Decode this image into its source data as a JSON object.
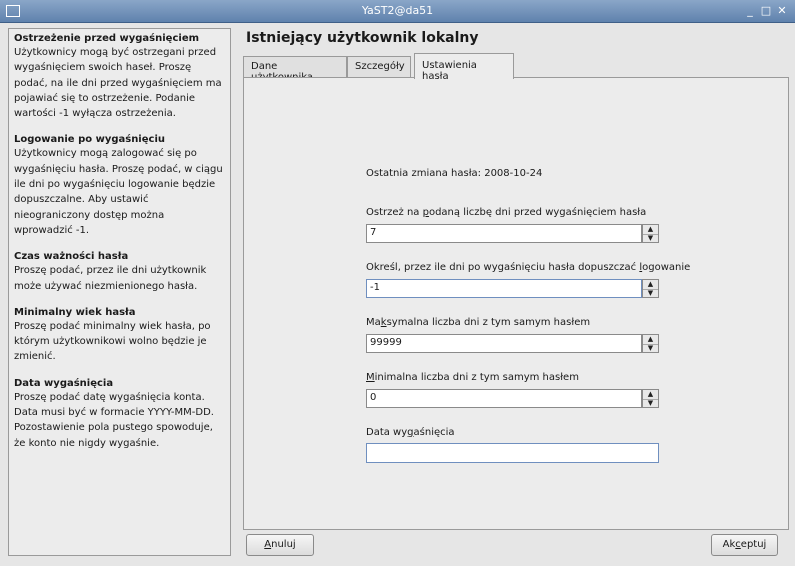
{
  "window": {
    "title": "YaST2@da51"
  },
  "help": [
    {
      "heading": "Ostrzeżenie przed wygaśnięciem",
      "body": "Użytkownicy mogą być ostrzegani przed wygaśnięciem swoich haseł. Proszę podać, na ile dni przed wygaśnięciem ma pojawiać się to ostrzeżenie. Podanie wartości -1 wyłącza ostrzeżenia."
    },
    {
      "heading": "Logowanie po wygaśnięciu",
      "body": "Użytkownicy mogą zalogować się po wygaśnięciu hasła. Proszę podać, w ciągu ile dni po wygaśnięciu logowanie będzie dopuszczalne. Aby ustawić nieograniczony dostęp można wprowadzić -1."
    },
    {
      "heading": "Czas ważności hasła",
      "body": "Proszę podać, przez ile dni użytkownik może używać niezmienionego hasła."
    },
    {
      "heading": "Minimalny wiek hasła",
      "body": "Proszę podać minimalny wiek hasła, po którym użytkownikowi wolno będzie je zmienić."
    },
    {
      "heading": "Data wygaśnięcia",
      "body": "Proszę podać datę wygaśnięcia konta. Data musi być w formacie YYYY-MM-DD. Pozostawienie pola pustego spowoduje, że konto nie nigdy wygaśnie."
    }
  ],
  "page_title": "Istniejący użytkownik lokalny",
  "tabs": [
    "Dane użytkownika",
    "Szczegóły",
    "Ustawienia hasła"
  ],
  "form": {
    "last_change": "Ostatnia zmiana hasła: 2008-10-24",
    "warn": {
      "label_pre": "Ostrzeż na ",
      "label_acc": "p",
      "label_post": "odaną liczbę dni przed wygaśnięciem hasła",
      "value": "7"
    },
    "inactive": {
      "label_pre": "Określ, przez ile dni po wygaśnięciu hasła dopuszczać ",
      "label_acc": "l",
      "label_post": "ogowanie",
      "value": "-1"
    },
    "max": {
      "label_pre": "Ma",
      "label_acc": "k",
      "label_post": "symalna liczba dni z tym samym hasłem",
      "value": "99999"
    },
    "min": {
      "label_pre": "",
      "label_acc": "M",
      "label_post": "inimalna liczba dni z tym samym hasłem",
      "value": "0"
    },
    "expire": {
      "label_pre": "Data wy",
      "label_acc": "g",
      "label_post": "aśnięcia",
      "value": ""
    }
  },
  "buttons": {
    "cancel": {
      "acc": "A",
      "rest": "nuluj"
    },
    "accept": {
      "pre": "Ak",
      "acc": "c",
      "post": "eptuj"
    }
  }
}
